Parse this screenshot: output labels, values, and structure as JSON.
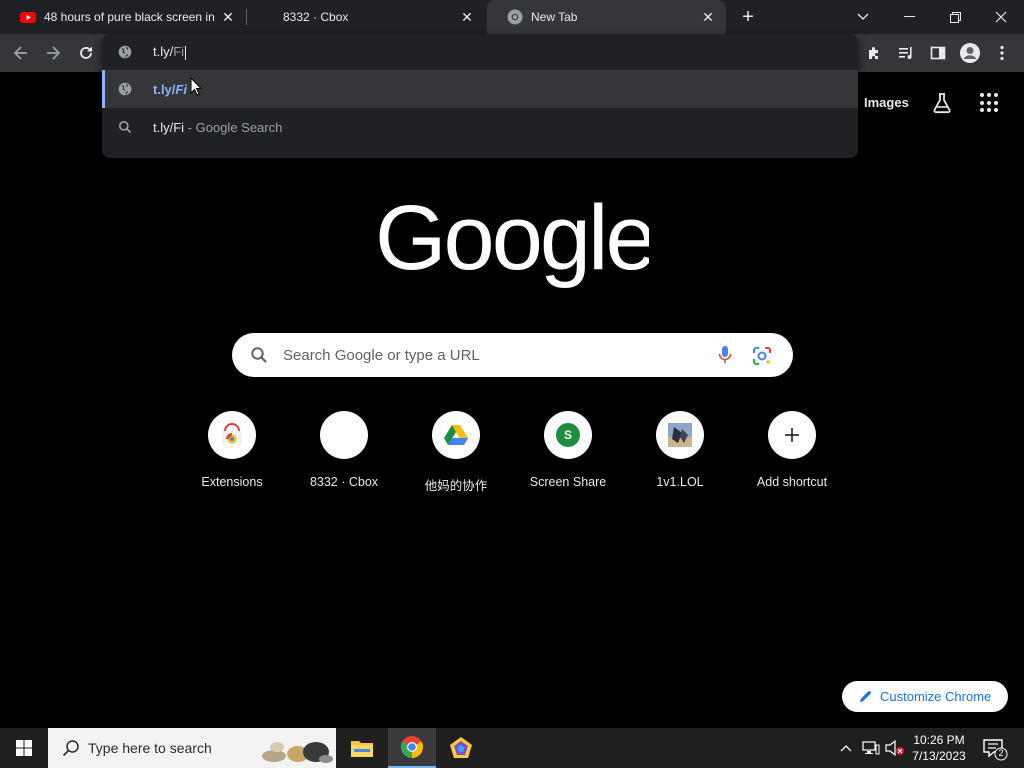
{
  "browser": {
    "tabs": [
      {
        "title": "48 hours of pure black screen in",
        "favicon": "youtube-icon",
        "active": false
      },
      {
        "title": "8332 · Cbox",
        "favicon": "none",
        "active": false
      },
      {
        "title": "New Tab",
        "favicon": "chrome-icon",
        "active": true
      }
    ],
    "new_tab_symbol": "+",
    "close_symbol": "✕",
    "window_controls": {
      "dropdown": "⌄",
      "minimize": "—",
      "restore": "❐",
      "close": "✕"
    }
  },
  "omnibox": {
    "typed": "t.ly/",
    "autocomplete": "Fi",
    "suggestions": [
      {
        "icon": "globe-icon",
        "url_bold": "t.ly/",
        "url_rest": "Fi",
        "selected": true
      },
      {
        "icon": "search-icon",
        "query": "t.ly/Fi",
        "separator": " - ",
        "provider": "Google Search",
        "selected": false
      }
    ]
  },
  "ntp": {
    "images_link": "Images",
    "search_placeholder": "Search Google or type a URL",
    "shortcuts": [
      {
        "label": "Extensions",
        "icon": "chrome-web-store-icon"
      },
      {
        "label": "8332 · Cbox",
        "icon": "blank-icon"
      },
      {
        "label": "他妈的协作",
        "icon": "google-drive-icon"
      },
      {
        "label": "Screen Share",
        "icon": "letter-s-icon",
        "letter": "S"
      },
      {
        "label": "1v1.LOL",
        "icon": "game-thumbnail-icon"
      },
      {
        "label": "Add shortcut",
        "icon": "plus-icon",
        "symbol": "+"
      }
    ],
    "customize_label": "Customize Chrome"
  },
  "taskbar": {
    "search_placeholder": "Type here to search",
    "time": "10:26 PM",
    "date": "7/13/2023",
    "notification_count": "2"
  },
  "colors": {
    "accent_blue": "#8ab4f8",
    "tab_strip": "#202124",
    "toolbar": "#35363a",
    "youtube_red": "#ff0000",
    "screen_share_green": "#1e8e3e"
  }
}
